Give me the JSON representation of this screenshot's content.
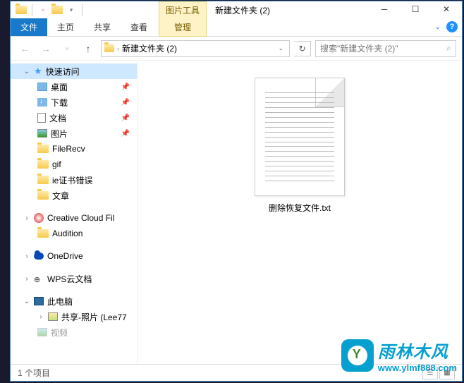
{
  "title": "新建文件夹 (2)",
  "tool_tab": "图片工具",
  "ribbon": {
    "file": "文件",
    "home": "主页",
    "share": "共享",
    "view": "查看",
    "manage": "管理"
  },
  "breadcrumb": {
    "current": "新建文件夹 (2)"
  },
  "search_placeholder": "搜索\"新建文件夹 (2)\"",
  "sidebar": {
    "quick_access": "快速访问",
    "items": [
      {
        "label": "桌面",
        "pin": true
      },
      {
        "label": "下载",
        "pin": true
      },
      {
        "label": "文档",
        "pin": true
      },
      {
        "label": "图片",
        "pin": true
      },
      {
        "label": "FileRecv",
        "pin": false
      },
      {
        "label": "gif",
        "pin": false
      },
      {
        "label": "ie证书错误",
        "pin": false
      },
      {
        "label": "文章",
        "pin": false
      }
    ],
    "cc": "Creative Cloud Fil",
    "audition": "Audition",
    "onedrive": "OneDrive",
    "wps": "WPS云文档",
    "this_pc": "此电脑",
    "shared": "共享-照片 (Lee77",
    "video": "视频"
  },
  "file": {
    "name": "删除恢复文件.txt"
  },
  "status": {
    "count": "1 个项目"
  },
  "watermark": {
    "title": "雨林木风",
    "url": "www.ylmf888.com"
  }
}
